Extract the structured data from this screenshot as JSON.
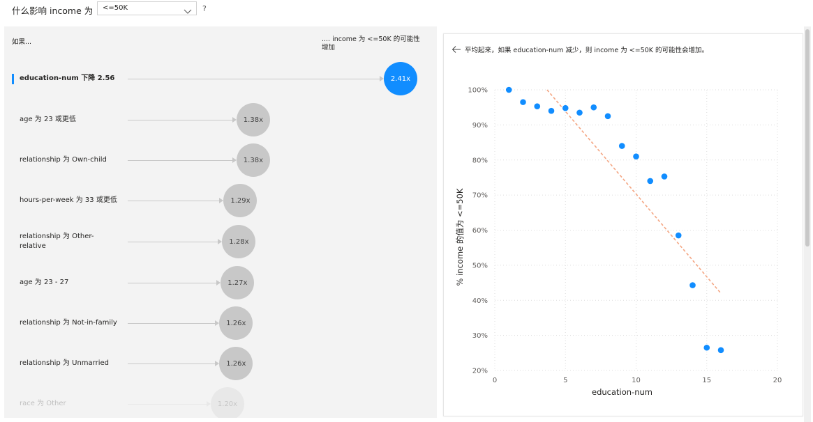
{
  "header": {
    "question_label": "什么影响 income 为",
    "dropdown_value": "<=50K",
    "help_label": "?"
  },
  "influencers": {
    "col_if": "如果...",
    "col_then": ".... income 为 <=50K 的可能性增加",
    "rows": [
      {
        "label": "education-num 下降 2.56",
        "value": "2.41x",
        "factor": 2.41,
        "active": true
      },
      {
        "label": "age 为 23 或更低",
        "value": "1.38x",
        "factor": 1.38,
        "active": false
      },
      {
        "label": "relationship 为 Own-child",
        "value": "1.38x",
        "factor": 1.38,
        "active": false
      },
      {
        "label": "hours-per-week 为 33 或更低",
        "value": "1.29x",
        "factor": 1.29,
        "active": false
      },
      {
        "label": "relationship 为 Other-relative",
        "value": "1.28x",
        "factor": 1.28,
        "active": false
      },
      {
        "label": "age 为 23 - 27",
        "value": "1.27x",
        "factor": 1.27,
        "active": false
      },
      {
        "label": "relationship 为 Not-in-family",
        "value": "1.26x",
        "factor": 1.26,
        "active": false
      },
      {
        "label": "relationship 为 Unmarried",
        "value": "1.26x",
        "factor": 1.26,
        "active": false
      },
      {
        "label": "race 为 Other",
        "value": "1.20x",
        "factor": 1.2,
        "active": false
      }
    ]
  },
  "detail": {
    "title": "平均起来，如果 education-num 减少，则 income 为 <=50K 的可能性会增加。"
  },
  "chart_data": {
    "type": "scatter",
    "xlabel": "education-num",
    "ylabel": "% income 的值为 <=50K",
    "xlim": [
      0,
      20
    ],
    "ylim": [
      20,
      100
    ],
    "xticks": [
      0,
      5,
      10,
      15,
      20
    ],
    "yticks": [
      20,
      30,
      40,
      50,
      60,
      70,
      80,
      90,
      100
    ],
    "ytick_labels": [
      "20%",
      "30%",
      "40%",
      "50%",
      "60%",
      "70%",
      "80%",
      "90%",
      "100%"
    ],
    "grid": true,
    "point_color": "#118dff",
    "trend_color": "#f4a582",
    "points": [
      {
        "x": 1,
        "y": 100
      },
      {
        "x": 2,
        "y": 96.5
      },
      {
        "x": 3,
        "y": 95.3
      },
      {
        "x": 4,
        "y": 94
      },
      {
        "x": 5,
        "y": 94.8
      },
      {
        "x": 6,
        "y": 93.5
      },
      {
        "x": 7,
        "y": 95
      },
      {
        "x": 8,
        "y": 92.5
      },
      {
        "x": 9,
        "y": 84
      },
      {
        "x": 10,
        "y": 81
      },
      {
        "x": 11,
        "y": 74
      },
      {
        "x": 12,
        "y": 75.3
      },
      {
        "x": 13,
        "y": 58.5
      },
      {
        "x": 14,
        "y": 44.3
      },
      {
        "x": 15,
        "y": 26.5
      },
      {
        "x": 16,
        "y": 25.8
      }
    ],
    "trendline": [
      {
        "x": 3.7,
        "y": 100
      },
      {
        "x": 16,
        "y": 42
      }
    ]
  }
}
